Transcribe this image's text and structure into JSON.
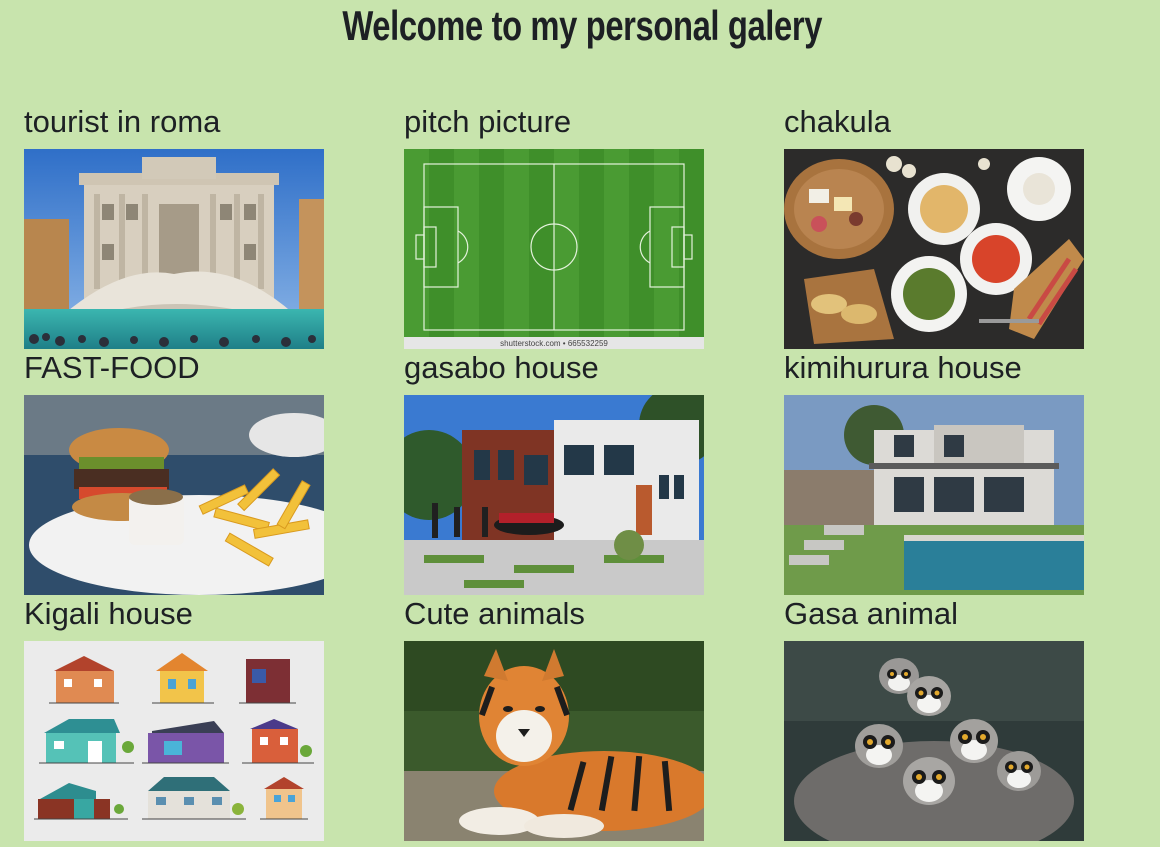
{
  "page": {
    "title": "Welcome to my personal galery"
  },
  "gallery": {
    "items": [
      {
        "title": "tourist in roma",
        "image": "trevi-fountain-photo"
      },
      {
        "title": "pitch picture",
        "image": "football-pitch-photo",
        "caption": "shutterstock.com • 665532259"
      },
      {
        "title": "chakula",
        "image": "food-platter-photo"
      },
      {
        "title": "FAST-FOOD",
        "image": "burger-and-fries-photo"
      },
      {
        "title": "gasabo house",
        "image": "modern-house-photo"
      },
      {
        "title": "kimihurura house",
        "image": "house-with-pool-photo"
      },
      {
        "title": "Kigali house",
        "image": "house-icons-illustration"
      },
      {
        "title": "Cute animals",
        "image": "tiger-photo"
      },
      {
        "title": "Gasa animal",
        "image": "lemurs-photo"
      }
    ]
  },
  "colors": {
    "background": "#c8e4ad",
    "text": "#1d2024"
  }
}
